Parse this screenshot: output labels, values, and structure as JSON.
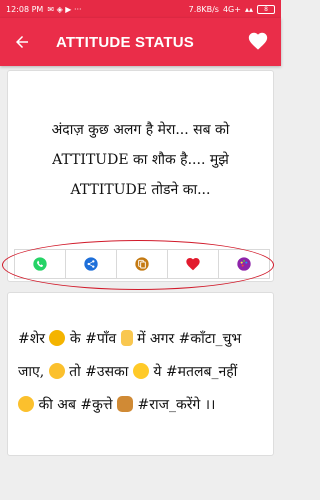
{
  "status_bar": {
    "time": "12:08 PM",
    "network_speed": "7.8KB/s",
    "network_type": "4G+",
    "battery": "8"
  },
  "app_bar": {
    "title": "ATTITUDE STATUS",
    "back_icon": "arrow-back-icon",
    "favorite_icon": "heart-icon"
  },
  "colors": {
    "primary": "#ea2d49",
    "whatsapp": "#25d366",
    "share": "#1e6fd9",
    "copy": "#c47a12",
    "favorite": "#e21b2e",
    "palette": "#8e24aa"
  },
  "cards": [
    {
      "lines": [
        "अंदाज़ कुछ अलग है मेरा... सब को",
        "ATTITUDE का शौक है.... मुझे",
        "ATTITUDE तोडने का..."
      ],
      "actions": [
        {
          "icon": "whatsapp-icon"
        },
        {
          "icon": "share-icon"
        },
        {
          "icon": "copy-icon"
        },
        {
          "icon": "heart-icon"
        },
        {
          "icon": "palette-icon"
        }
      ]
    },
    {
      "segments": [
        "#शेर ",
        " के #पाँव ",
        " में अगर #काँटा_चुभ",
        "जाए, ",
        " तो #उसका ",
        " ये #मतलब_नहीं",
        " की अब #कुत्ते ",
        " #राज_करेंगे ।।"
      ]
    }
  ]
}
